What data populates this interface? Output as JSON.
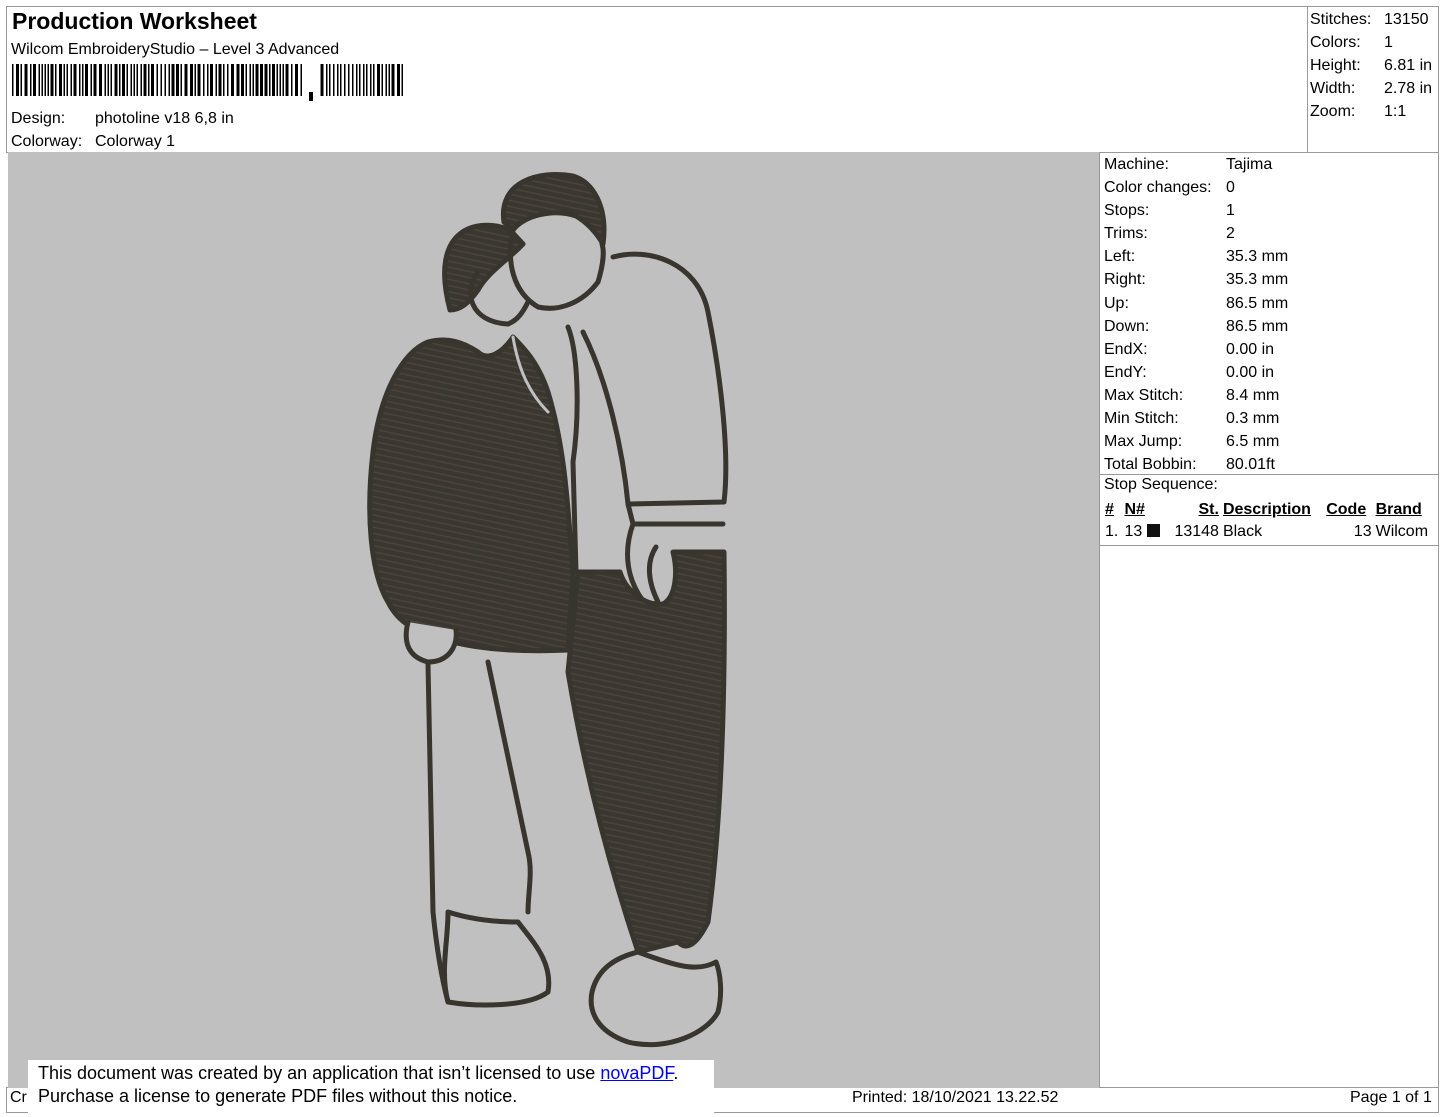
{
  "header": {
    "title": "Production Worksheet",
    "software": "Wilcom EmbroideryStudio – Level 3 Advanced",
    "design_label": "Design:",
    "design_value": "photoline v18 6,8 in",
    "colorway_label": "Colorway:",
    "colorway_value": "Colorway 1"
  },
  "summary": [
    {
      "label": "Stitches:",
      "value": "13150"
    },
    {
      "label": "Colors:",
      "value": "1"
    },
    {
      "label": "Height:",
      "value": "6.81 in"
    },
    {
      "label": "Width:",
      "value": "2.78 in"
    },
    {
      "label": "Zoom:",
      "value": "1:1"
    }
  ],
  "machine_info": [
    {
      "label": "Machine:",
      "value": "Tajima"
    },
    {
      "label": "Color changes:",
      "value": "0"
    },
    {
      "label": "Stops:",
      "value": "1"
    },
    {
      "label": "Trims:",
      "value": "2"
    },
    {
      "label": "Left:",
      "value": "35.3 mm"
    },
    {
      "label": "Right:",
      "value": "35.3 mm"
    },
    {
      "label": "Up:",
      "value": "86.5 mm"
    },
    {
      "label": "Down:",
      "value": "86.5 mm"
    },
    {
      "label": "EndX:",
      "value": "0.00 in"
    },
    {
      "label": "EndY:",
      "value": "0.00 in"
    },
    {
      "label": "Max Stitch:",
      "value": "8.4 mm"
    },
    {
      "label": "Min Stitch:",
      "value": "0.3 mm"
    },
    {
      "label": "Max Jump:",
      "value": "6.5 mm"
    },
    {
      "label": "Total Bobbin:",
      "value": "80.01ft"
    }
  ],
  "stop_sequence": {
    "title": "Stop Sequence:",
    "headers": [
      "#",
      "N#",
      "St.",
      "Description",
      "Code",
      "Brand"
    ],
    "rows": [
      {
        "index": "1.",
        "needle": "13",
        "swatch_color": "#111111",
        "stitches": "13148",
        "description": "Black",
        "code": "13",
        "brand": "Wilcom"
      }
    ]
  },
  "notice": {
    "line1": "This document was created by an application that isn’t licensed to use ",
    "link": "novaPDF",
    "line1_end": ".",
    "line2": "Purchase a license to generate PDF files without this notice."
  },
  "footer": {
    "left": "Cr",
    "printed": "Printed: 18/10/2021 13.22.52",
    "page": "Page 1 of 1"
  },
  "colors": {
    "canvas": "#c0c0c0",
    "thread": "#38352f",
    "link": "#0000ee"
  }
}
